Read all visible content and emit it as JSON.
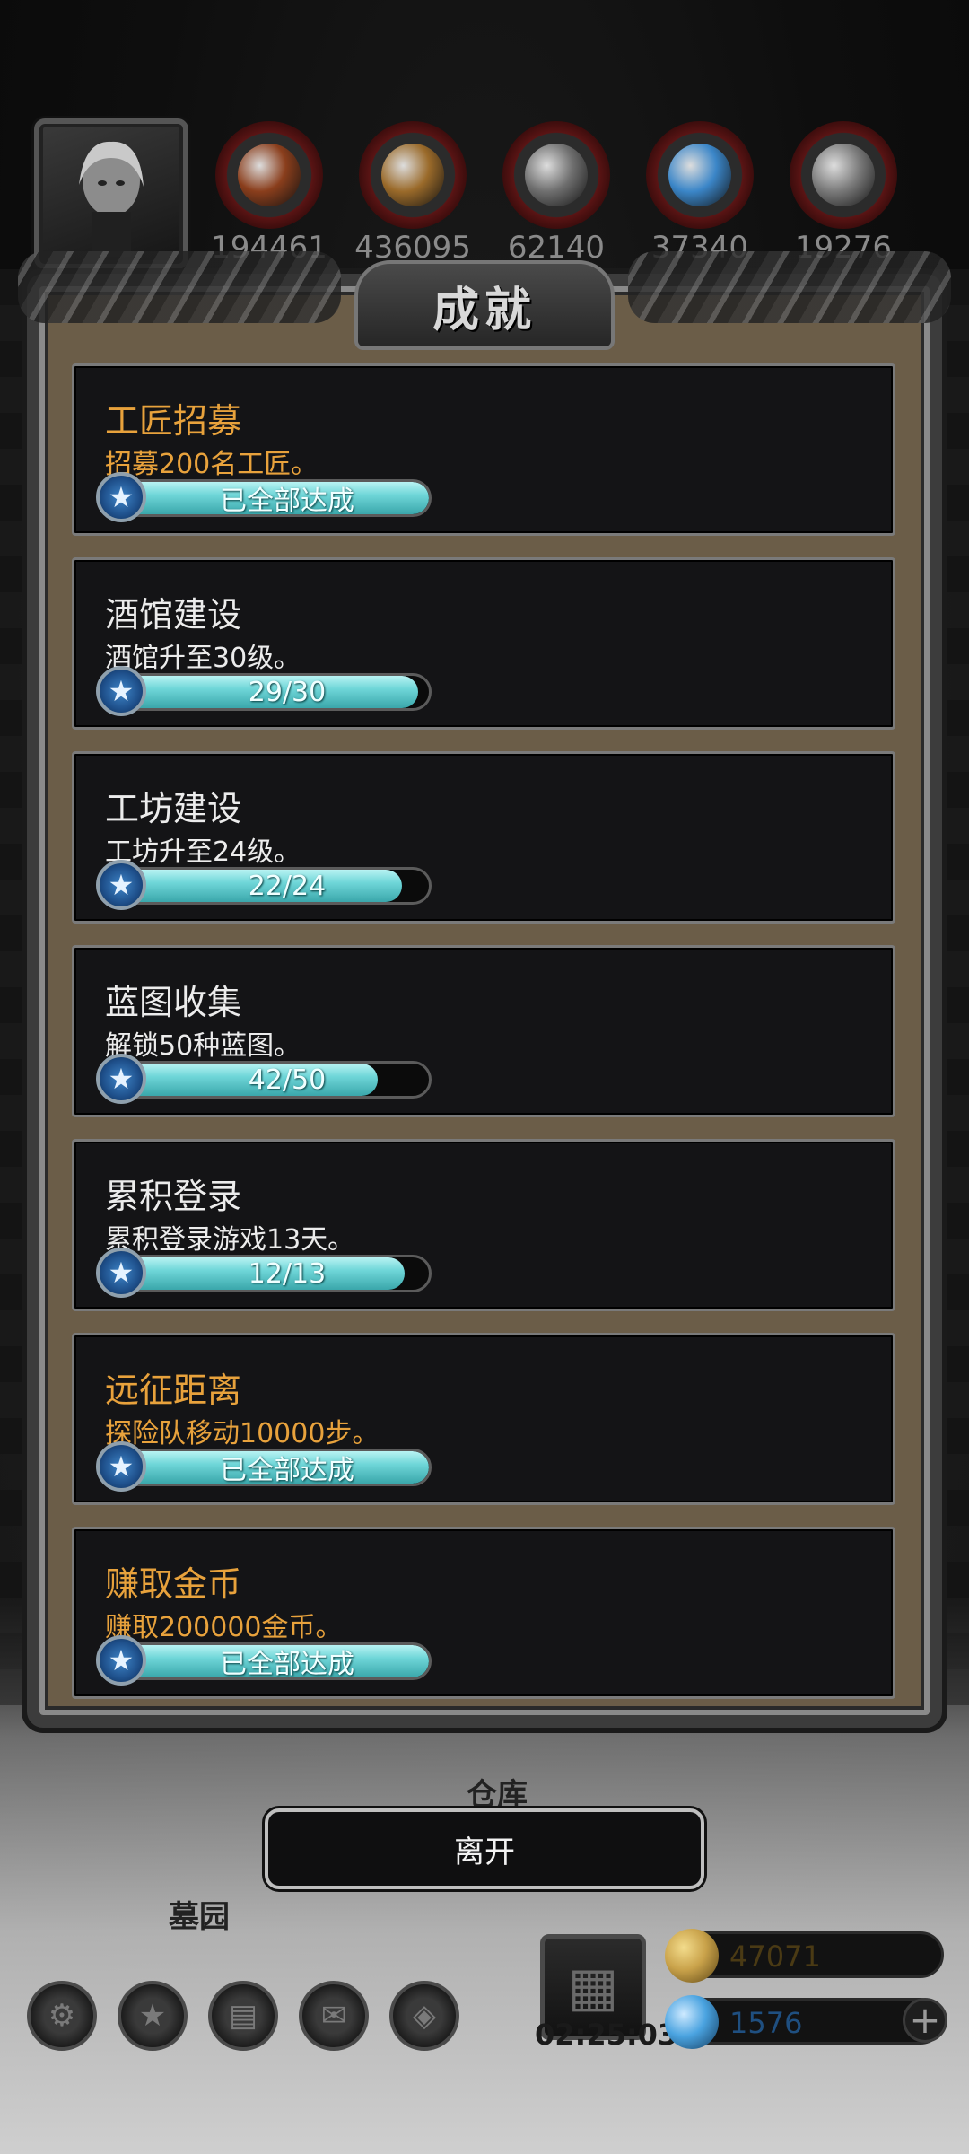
{
  "resources": [
    {
      "name": "meat",
      "count": "194461",
      "color": "#8a3e1c"
    },
    {
      "name": "wood",
      "count": "436095",
      "color": "#9a6a2a"
    },
    {
      "name": "iron",
      "count": "62140",
      "color": "#6f6f6f"
    },
    {
      "name": "crystal",
      "count": "37340",
      "color": "#3b86c8"
    },
    {
      "name": "steel",
      "count": "19276",
      "color": "#7a7a7a"
    }
  ],
  "panel": {
    "title": "成就"
  },
  "achievements": [
    {
      "title": "工匠招募",
      "desc": "招募200名工匠。",
      "progress_text": "已全部达成",
      "progress": 1.0,
      "done": true
    },
    {
      "title": "酒馆建设",
      "desc": "酒馆升至30级。",
      "progress_text": "29/30",
      "progress": 0.967,
      "done": false
    },
    {
      "title": "工坊建设",
      "desc": "工坊升至24级。",
      "progress_text": "22/24",
      "progress": 0.917,
      "done": false
    },
    {
      "title": "蓝图收集",
      "desc": "解锁50种蓝图。",
      "progress_text": "42/50",
      "progress": 0.84,
      "done": false
    },
    {
      "title": "累积登录",
      "desc": "累积登录游戏13天。",
      "progress_text": "12/13",
      "progress": 0.923,
      "done": false
    },
    {
      "title": "远征距离",
      "desc": "探险队移动10000步。",
      "progress_text": "已全部达成",
      "progress": 1.0,
      "done": true
    },
    {
      "title": "赚取金币",
      "desc": "赚取200000金币。",
      "progress_text": "已全部达成",
      "progress": 1.0,
      "done": true
    }
  ],
  "map_labels": {
    "warehouse": "仓库",
    "cemetery": "墓园"
  },
  "leave_button": "离开",
  "hud": {
    "timer": "02:25:03",
    "gold": "47071",
    "gems": "1576",
    "gold_color": "#c9a24a",
    "gem_color": "#4aa3e0"
  },
  "colors": {
    "done_text": "#e8a23c",
    "bar_fill": "#6fd6d8"
  }
}
